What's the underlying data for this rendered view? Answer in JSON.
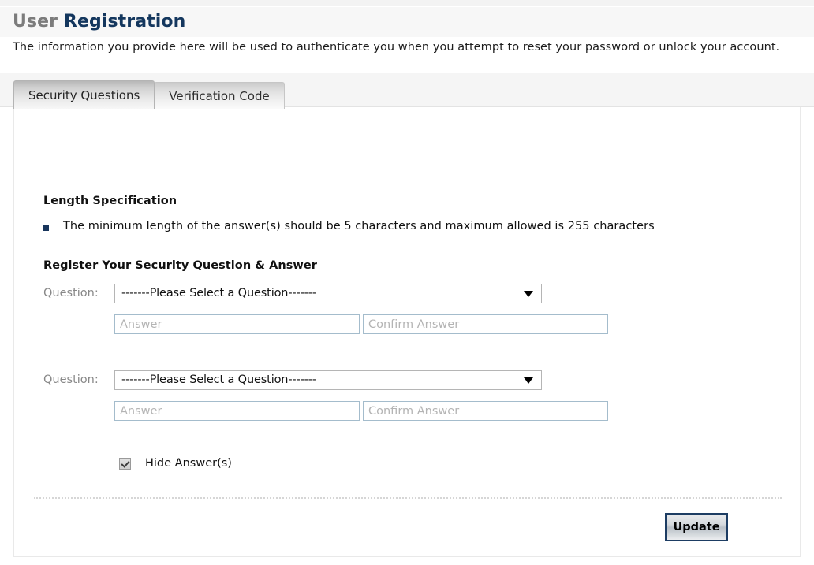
{
  "header": {
    "title_light": "User",
    "title_dark": "Registration",
    "subtitle": "The information you provide here will be used to authenticate you when you attempt to reset your password or unlock your account."
  },
  "tabs": [
    {
      "label": "Security Questions",
      "active": true
    },
    {
      "label": "Verification Code",
      "active": false
    }
  ],
  "length_spec": {
    "heading": "Length Specification",
    "bullets": [
      "The minimum length of the answer(s) should be 5 characters and maximum allowed is 255 characters"
    ]
  },
  "register": {
    "heading": "Register Your Security Question & Answer",
    "question_label": "Question:",
    "select_placeholder": "-------Please Select a Question-------",
    "answer_placeholder": "Answer",
    "confirm_placeholder": "Confirm Answer",
    "rows": [
      {
        "question_label": "Question:",
        "selected_option": "-------Please Select a Question-------",
        "answer_value": "",
        "answer_placeholder": "Answer",
        "confirm_value": "",
        "confirm_placeholder": "Confirm Answer"
      },
      {
        "question_label": "Question:",
        "selected_option": "-------Please Select a Question-------",
        "answer_value": "",
        "answer_placeholder": "Answer",
        "confirm_value": "",
        "confirm_placeholder": "Confirm Answer"
      }
    ]
  },
  "hide_answers": {
    "label": "Hide Answer(s)",
    "checked": true
  },
  "footer": {
    "update_label": "Update"
  },
  "colors": {
    "title_light": "#7c7c7c",
    "title_dark": "#14375e",
    "bullet": "#18355c",
    "input_border": "#a4bccc",
    "button_border": "#1d3d63",
    "divider": "#d6d6d6"
  }
}
